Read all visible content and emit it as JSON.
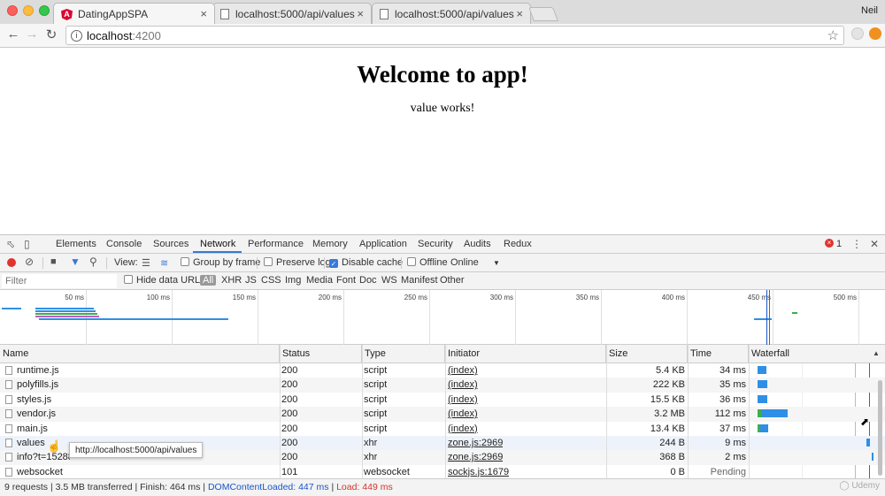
{
  "browser": {
    "tabs": [
      {
        "title": "DatingAppSPA",
        "active": true
      },
      {
        "title": "localhost:5000/api/values",
        "active": false
      },
      {
        "title": "localhost:5000/api/values",
        "active": false
      }
    ],
    "profile": "Neil",
    "url_host": "localhost",
    "url_port": ":4200",
    "close_glyph": "×"
  },
  "page": {
    "heading": "Welcome to app!",
    "text": "value works!"
  },
  "devtools": {
    "tabs": [
      "Elements",
      "Console",
      "Sources",
      "Network",
      "Performance",
      "Memory",
      "Application",
      "Security",
      "Audits",
      "Redux"
    ],
    "active_tab": "Network",
    "error_count": "1",
    "toolbar": {
      "view_label": "View:",
      "group_by_frame": "Group by frame",
      "preserve_log": "Preserve log",
      "disable_cache": "Disable cache",
      "offline": "Offline",
      "throttling": "Online"
    },
    "filter": {
      "placeholder": "Filter",
      "hide_data_urls": "Hide data URLs",
      "types": [
        "All",
        "XHR",
        "JS",
        "CSS",
        "Img",
        "Media",
        "Font",
        "Doc",
        "WS",
        "Manifest",
        "Other"
      ]
    },
    "overview_ticks": [
      "50 ms",
      "100 ms",
      "150 ms",
      "200 ms",
      "250 ms",
      "300 ms",
      "350 ms",
      "400 ms",
      "450 ms",
      "500 ms"
    ],
    "columns": [
      "Name",
      "Status",
      "Type",
      "Initiator",
      "Size",
      "Time",
      "Waterfall"
    ],
    "requests": [
      {
        "name": "runtime.js",
        "status": "200",
        "type": "script",
        "initiator": "(index)",
        "size": "5.4 KB",
        "time": "34 ms"
      },
      {
        "name": "polyfills.js",
        "status": "200",
        "type": "script",
        "initiator": "(index)",
        "size": "222 KB",
        "time": "35 ms"
      },
      {
        "name": "styles.js",
        "status": "200",
        "type": "script",
        "initiator": "(index)",
        "size": "15.5 KB",
        "time": "36 ms"
      },
      {
        "name": "vendor.js",
        "status": "200",
        "type": "script",
        "initiator": "(index)",
        "size": "3.2 MB",
        "time": "112 ms"
      },
      {
        "name": "main.js",
        "status": "200",
        "type": "script",
        "initiator": "(index)",
        "size": "13.4 KB",
        "time": "37 ms"
      },
      {
        "name": "values",
        "status": "200",
        "type": "xhr",
        "initiator": "zone.js:2969",
        "size": "244 B",
        "time": "9 ms"
      },
      {
        "name": "info?t=152882",
        "status": "200",
        "type": "xhr",
        "initiator": "zone.js:2969",
        "size": "368 B",
        "time": "2 ms"
      },
      {
        "name": "websocket",
        "status": "101",
        "type": "websocket",
        "initiator": "sockjs.js:1679",
        "size": "0 B",
        "time": "Pending"
      }
    ],
    "tooltip": "http://localhost:5000/api/values",
    "status": {
      "summary": "9 requests | 3.5 MB transferred | Finish: 464 ms | ",
      "dcl": "DOMContentLoaded: 447 ms",
      "divider": " | ",
      "load": "Load: 449 ms"
    }
  },
  "colors": {
    "accent": "#3879d9",
    "record": "#e0342e",
    "waterfall_bar": "#2f8fe6",
    "waterfall_wait": "#3fae49",
    "dcl_line": "#1a55c9",
    "load_line": "#d0352b"
  }
}
